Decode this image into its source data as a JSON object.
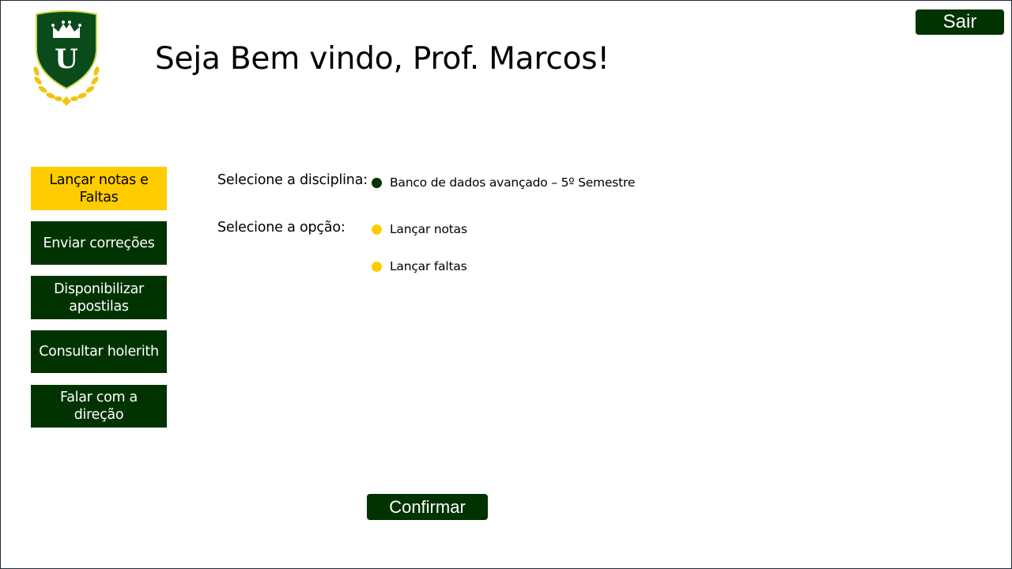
{
  "header": {
    "welcome": "Seja Bem vindo, Prof. Marcos!",
    "logout_label": "Sair",
    "logo_letter": "U"
  },
  "sidebar": {
    "items": [
      {
        "label": "Lançar notas e Faltas",
        "active": true
      },
      {
        "label": "Enviar correções",
        "active": false
      },
      {
        "label": "Disponibilizar apostilas",
        "active": false
      },
      {
        "label": "Consultar holerith",
        "active": false
      },
      {
        "label": "Falar com a direção",
        "active": false
      }
    ]
  },
  "form": {
    "discipline_label": "Selecione a disciplina:",
    "discipline_options": [
      {
        "label": "Banco de dados avançado – 5º Semestre",
        "color": "#003300"
      }
    ],
    "option_label": "Selecione a opção:",
    "options": [
      {
        "label": "Lançar notas",
        "color": "#ffcc00"
      },
      {
        "label": "Lançar faltas",
        "color": "#ffcc00"
      }
    ],
    "confirm_label": "Confirmar"
  },
  "colors": {
    "primary": "#003300",
    "accent": "#ffcc00",
    "logo_shield": "#0b4a1a",
    "logo_gold": "#f2c40f"
  }
}
